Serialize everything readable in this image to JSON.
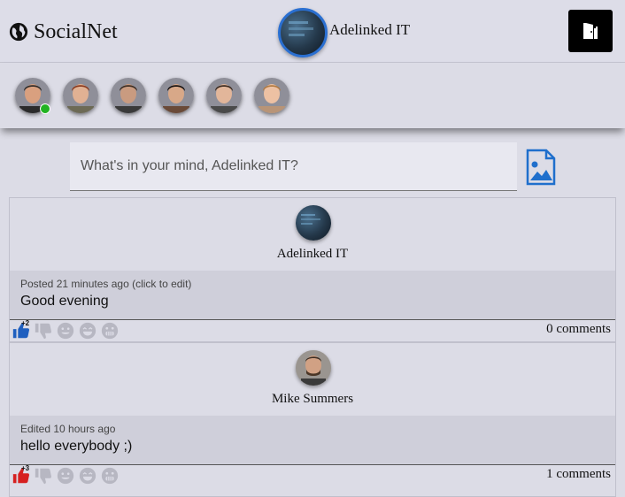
{
  "header": {
    "app_title": "SocialNet",
    "user_name": "Adelinked IT",
    "logo_icon": "globe-icon",
    "logout_icon": "door-exit-icon"
  },
  "friends": [
    {
      "name": "friend-1",
      "online": true,
      "skin": "#d9a07f",
      "hair": "#2d2a28",
      "shirt": "#2b2b2b"
    },
    {
      "name": "friend-2",
      "online": false,
      "skin": "#e1b193",
      "hair": "#8a3a1e",
      "shirt": "#6d6a55"
    },
    {
      "name": "friend-3",
      "online": false,
      "skin": "#c99b80",
      "hair": "#3b2d24",
      "shirt": "#3a3a3a"
    },
    {
      "name": "friend-4",
      "online": false,
      "skin": "#d8a888",
      "hair": "#141010",
      "shirt": "#6a4a38"
    },
    {
      "name": "friend-5",
      "online": false,
      "skin": "#e2b69a",
      "hair": "#3a2a20",
      "shirt": "#4a4a4a"
    },
    {
      "name": "friend-6",
      "online": false,
      "skin": "#edc1a3",
      "hair": "#b07a42",
      "shirt": "#b89477"
    }
  ],
  "composer": {
    "placeholder": "What's in your mind, Adelinked IT?",
    "photo_icon": "image-upload-icon"
  },
  "posts": [
    {
      "author": "Adelinked IT",
      "meta": "Posted 21 minutes ago (click to edit)",
      "text": "Good evening",
      "like_count": "+2",
      "like_color": "#1f5fbf",
      "comments": "0 comments"
    },
    {
      "author": "Mike Summers",
      "meta": "Edited 10 hours ago",
      "text": "hello everybody ;)",
      "like_count": "+3",
      "like_color": "#d62020",
      "comments": "1 comments"
    }
  ],
  "colors": {
    "accent": "#2a6fd1",
    "online": "#22b322",
    "inactive_reaction": "#b7b7c2"
  }
}
